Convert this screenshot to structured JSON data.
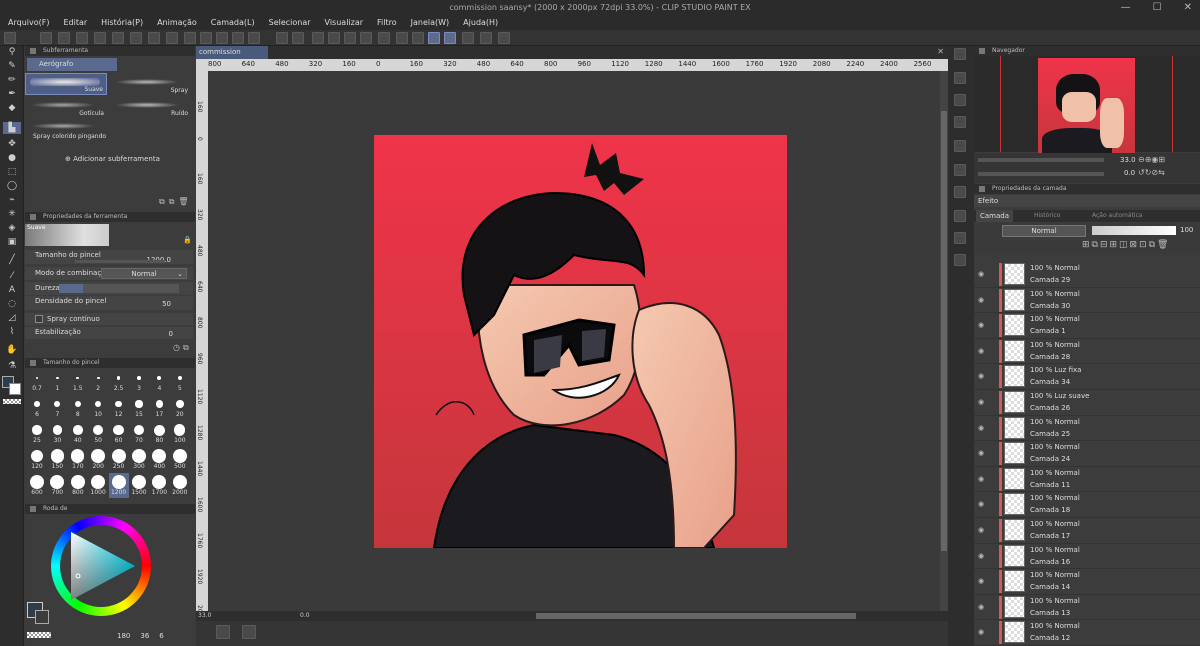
{
  "window": {
    "title": "commission saansy* (2000 x 2000px 72dpi 33.0%)  - CLIP STUDIO PAINT EX",
    "controls": [
      "—",
      "☐",
      "✕"
    ]
  },
  "menu": [
    "Arquivo(F)",
    "Editar",
    "História(P)",
    "Animação",
    "Camada(L)",
    "Selecionar",
    "Visualizar",
    "Filtro",
    "Janela(W)",
    "Ajuda(H)"
  ],
  "subtool": {
    "header": "Subferramenta",
    "group": "Aerógrafo",
    "items": [
      "Suave",
      "Spray",
      "Gotícula",
      "Ruído",
      "Spray colorido pingando"
    ],
    "add_label": "Adicionar subferramenta"
  },
  "tool_props": {
    "header": "Propriedades da ferramenta",
    "preset": "Suave",
    "brush_size_label": "Tamanho do pincel",
    "brush_size_value": "1200.0",
    "blend_label": "Modo de combinação",
    "blend_value": "Normal",
    "hardness_label": "Dureza",
    "density_label": "Densidade do pincel",
    "density_value": "50",
    "spray_label": "Spray contínuo",
    "stabil_label": "Estabilização",
    "stabil_value": "0"
  },
  "brush_size_panel": {
    "header": "Tamanho do pincel",
    "sizes": [
      "0.7",
      "1",
      "1.5",
      "2",
      "2.5",
      "3",
      "4",
      "5",
      "6",
      "7",
      "8",
      "10",
      "12",
      "15",
      "17",
      "20",
      "25",
      "30",
      "40",
      "50",
      "60",
      "70",
      "80",
      "100",
      "120",
      "150",
      "170",
      "200",
      "250",
      "300",
      "400",
      "500",
      "600",
      "700",
      "800",
      "1000",
      "1200",
      "1500",
      "1700",
      "2000"
    ],
    "selected": "1200"
  },
  "color_wheel": {
    "header": "Roda de",
    "readout": [
      "180",
      "36",
      "6"
    ],
    "main_color": "#2f3c4a"
  },
  "document": {
    "tab": "commission saansy*"
  },
  "ruler": {
    "h_ticks": [
      "800",
      "640",
      "480",
      "320",
      "160",
      "0",
      "160",
      "320",
      "480",
      "640",
      "800",
      "960",
      "1120",
      "1280",
      "1440",
      "1600",
      "1760",
      "1920",
      "2080",
      "2240",
      "2400",
      "2560"
    ],
    "v_ticks": [
      "160",
      "0",
      "160",
      "320",
      "480",
      "640",
      "800",
      "960",
      "1120",
      "1280",
      "1440",
      "1600",
      "1760",
      "1920",
      "2080"
    ]
  },
  "status": {
    "zoom": "33.0",
    "angle": "0.0"
  },
  "navigator": {
    "header": "Navegador",
    "zoom": "33.0",
    "angle": "0.0"
  },
  "layer_props": {
    "header": "Propriedades da camada",
    "effect_label": "Efeito"
  },
  "layer_panel": {
    "tabs": [
      "Camada",
      "Histórico",
      "Ação automática"
    ],
    "blend": "Normal",
    "opacity": "100",
    "layers": [
      {
        "mode": "100 % Normal",
        "name": "Camada 29"
      },
      {
        "mode": "100 % Normal",
        "name": "Camada 30"
      },
      {
        "mode": "100 % Normal",
        "name": "Camada 1"
      },
      {
        "mode": "100 % Normal",
        "name": "Camada 28"
      },
      {
        "mode": "100 % Luz fixa",
        "name": "Camada 34"
      },
      {
        "mode": "100 % Luz suave",
        "name": "Camada 26"
      },
      {
        "mode": "100 % Normal",
        "name": "Camada 25"
      },
      {
        "mode": "100 % Normal",
        "name": "Camada 24"
      },
      {
        "mode": "100 % Normal",
        "name": "Camada 11"
      },
      {
        "mode": "100 % Normal",
        "name": "Camada 18"
      },
      {
        "mode": "100 % Normal",
        "name": "Camada 17"
      },
      {
        "mode": "100 % Normal",
        "name": "Camada 16"
      },
      {
        "mode": "100 % Normal",
        "name": "Camada 14"
      },
      {
        "mode": "100 % Normal",
        "name": "Camada 13"
      },
      {
        "mode": "100 % Normal",
        "name": "Camada 12"
      }
    ]
  },
  "colors": {
    "accent": "#5d6a8f",
    "canvas_bg_top": "#f0344a",
    "canvas_bg_bottom": "#c43a3a",
    "layer_marker": "#d35a5a"
  }
}
